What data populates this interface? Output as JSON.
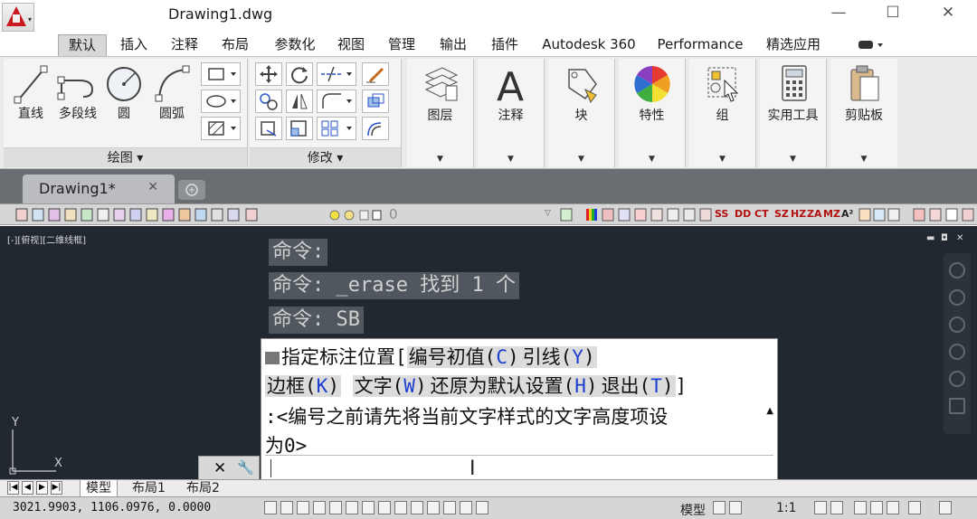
{
  "window": {
    "title": "Drawing1.dwg",
    "minimize_glyph": "—",
    "maximize_glyph": "☐",
    "close_glyph": "✕"
  },
  "ribbon_tabs": [
    "默认",
    "插入",
    "注释",
    "布局",
    "参数化",
    "视图",
    "管理",
    "输出",
    "插件",
    "Autodesk 360",
    "Performance",
    "精选应用"
  ],
  "ribbon_tabs_active": "默认",
  "draw_group": {
    "title": "绘图 ▾",
    "tools": [
      "直线",
      "多段线",
      "圆",
      "圆弧"
    ]
  },
  "modify_group": {
    "title": "修改 ▾"
  },
  "panels": [
    "图层",
    "注释",
    "块",
    "特性",
    "组",
    "实用工具",
    "剪贴板"
  ],
  "file_tab": {
    "name": "Drawing1*",
    "close": "✕"
  },
  "toolbar_strip": {
    "layer_value": "0",
    "dim_buttons": [
      "SS",
      "DD",
      "CT",
      "SZ",
      "HZ",
      "ZA",
      "MZ",
      "A²"
    ]
  },
  "viewport": {
    "label": "[-][俯视][二维线框]",
    "controls": [
      "▬",
      "◘",
      "✕"
    ]
  },
  "history": [
    "命令:",
    "命令: _erase 找到 1 个",
    "命令: SB"
  ],
  "command_window": {
    "line1_prefix": "指定标注位置[",
    "opt_start_num": "编号初值(",
    "opt_start_num_key": "C",
    "opt_leader": "引线(",
    "opt_leader_key": "Y",
    "opt_border": "边框(",
    "opt_border_key": "K",
    "opt_text": "文字(",
    "opt_text_key": "W",
    "opt_reset": "还原为默认设置(",
    "opt_reset_key": "H",
    "opt_exit": "退出(",
    "opt_exit_key": "T",
    "close_paren": ")",
    "close_bracket": "]",
    "line3": ":<编号之前请先将当前文字样式的文字高度项设",
    "line4": "为0>"
  },
  "command_grip": {
    "close": "✕",
    "customize": "🔧"
  },
  "ucs": {
    "y": "Y",
    "x": "X"
  },
  "layout_tabs": [
    "模型",
    "布局1",
    "布局2"
  ],
  "layout_tabs_active": "模型",
  "status_bar": {
    "coordinates": "3021.9903, 1106.0976, 0.0000",
    "model_label": "模型",
    "scale": "1:1"
  }
}
